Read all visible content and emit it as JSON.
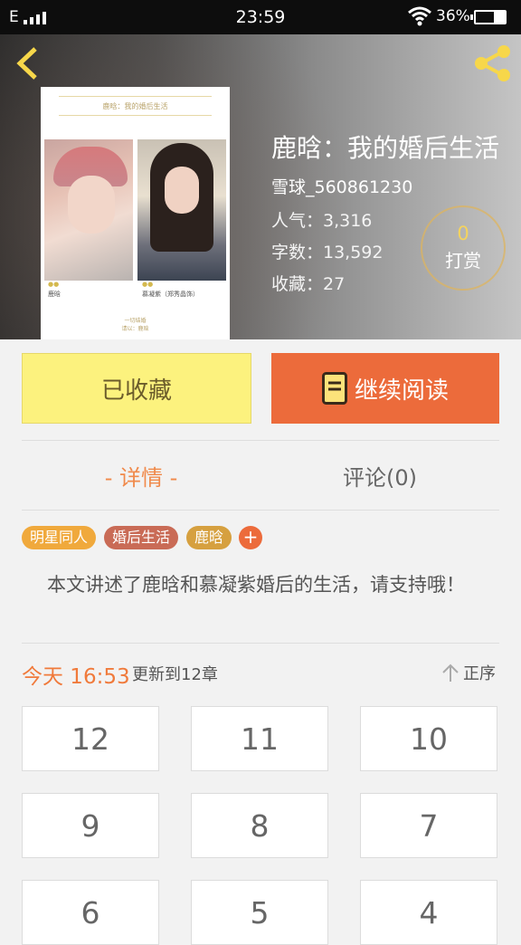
{
  "status_bar": {
    "network": "E",
    "time": "23:59",
    "battery": "36%",
    "battery_level": 0.36
  },
  "book": {
    "title": "鹿晗：我的婚后生活",
    "author": "雪球_560861230",
    "stats": [
      "人气：3,316",
      "字数：13,592",
      "收藏：27"
    ],
    "cover": {
      "title": "鹿晗：我的婚后生活",
      "caption_left": "鹿晗",
      "caption_right": "慕凝紫（郑秀晶饰）",
      "sign_line1": "一切结婚",
      "sign_line2": "请以：鹿晗"
    }
  },
  "reward": {
    "count": "0",
    "label": "打赏"
  },
  "actions": {
    "favorite_label": "已收藏",
    "read_label": "继续阅读"
  },
  "tabs": {
    "detail": "- 详情 -",
    "comment": "评论(0)"
  },
  "tags": [
    {
      "label": "明星同人",
      "color": "#f0a93c"
    },
    {
      "label": "婚后生活",
      "color": "#c96b56"
    },
    {
      "label": "鹿晗",
      "color": "#d6a03f"
    }
  ],
  "tag_add": "+",
  "summary": "本文讲述了鹿晗和慕凝紫婚后的生活，请支持哦！",
  "update": {
    "time": "今天 16:53",
    "text": "更新到12章",
    "sort_label": "正序"
  },
  "chapters": [
    "12",
    "11",
    "10",
    "9",
    "8",
    "7",
    "6",
    "5",
    "4"
  ],
  "colors": {
    "accent": "#ec6b3b",
    "favorite": "#fcf27e",
    "icon_gold": "#f7d74a"
  }
}
